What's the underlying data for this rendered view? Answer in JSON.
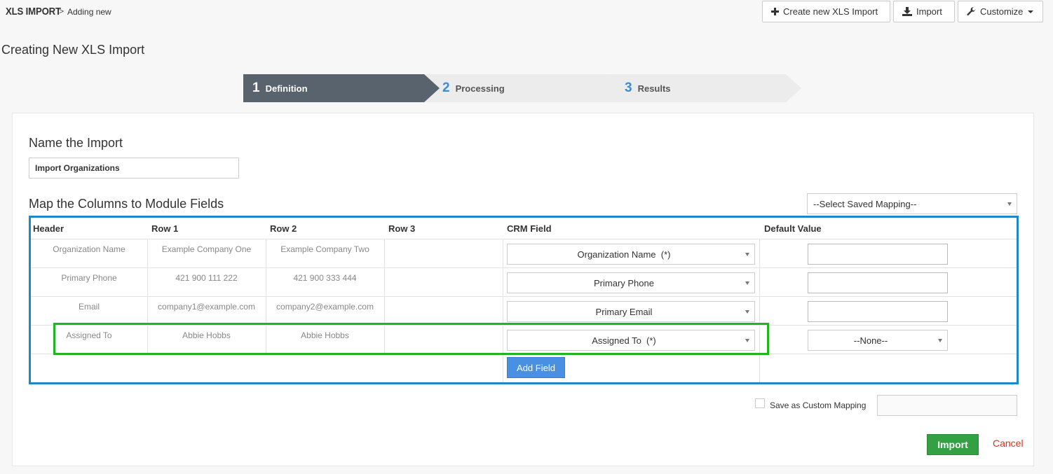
{
  "header": {
    "brand": "XLS IMPORT",
    "breadcrumb_separator": ">",
    "breadcrumb_current": "Adding new",
    "buttons": {
      "create_new": "Create new XLS Import",
      "import": "Import",
      "customize": "Customize"
    }
  },
  "page_title": "Creating New XLS Import",
  "wizard": {
    "steps": [
      {
        "num": "1",
        "label": "Definition",
        "active": true
      },
      {
        "num": "2",
        "label": "Processing",
        "active": false
      },
      {
        "num": "3",
        "label": "Results",
        "active": false
      }
    ]
  },
  "name_section": {
    "title": "Name the Import",
    "value": "Import Organizations"
  },
  "mapping_section": {
    "title": "Map the Columns to Module Fields",
    "saved_mapping_placeholder": "--Select Saved Mapping--",
    "columns": [
      "Header",
      "Row 1",
      "Row 2",
      "Row 3",
      "CRM Field",
      "Default Value"
    ],
    "rows": [
      {
        "header": "Organization Name",
        "row1": "Example Company One",
        "row2": "Example Company Two",
        "row3": "",
        "crm_field": "Organization Name  (*)",
        "default_type": "input",
        "default_value": ""
      },
      {
        "header": "Primary Phone",
        "row1": "421 900 111 222",
        "row2": "421 900 333 444",
        "row3": "",
        "crm_field": "Primary Phone",
        "default_type": "input",
        "default_value": ""
      },
      {
        "header": "Email",
        "row1": "company1@example.com",
        "row2": "company2@example.com",
        "row3": "",
        "crm_field": "Primary Email",
        "default_type": "input",
        "default_value": ""
      },
      {
        "header": "Assigned To",
        "row1": "Abbie Hobbs",
        "row2": "Abbie Hobbs",
        "row3": "",
        "crm_field": "Assigned To  (*)",
        "default_type": "select",
        "default_value": "--None--"
      }
    ],
    "add_field_label": "Add Field"
  },
  "footer": {
    "save_custom_mapping_label": "Save as Custom Mapping",
    "save_custom_mapping_checked": false,
    "import_label": "Import",
    "cancel_label": "Cancel"
  },
  "colors": {
    "step_active": "#59636d",
    "step_number": "#3d8bd6",
    "table_border": "#1e88c7",
    "highlight_border": "#22b522",
    "add_field": "#4a90e2",
    "import_button": "#33a043",
    "cancel_link": "#d9301e"
  }
}
